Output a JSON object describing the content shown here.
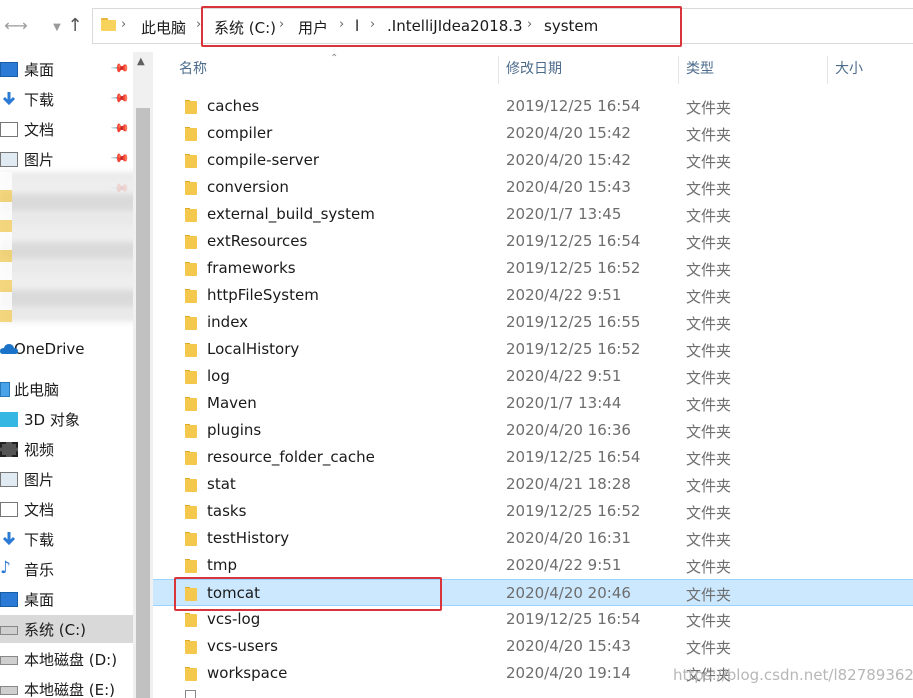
{
  "address_bar": {
    "breadcrumbs": [
      "此电脑",
      "系统 (C:)",
      "用户",
      "l",
      ".IntelliJIdea2018.3",
      "system"
    ],
    "highlight_color": "#d9343a"
  },
  "nav_pane": {
    "quick_access": [
      {
        "label": "桌面",
        "icon": "desktop-icon"
      },
      {
        "label": "下载",
        "icon": "download-icon"
      },
      {
        "label": "文档",
        "icon": "document-icon"
      },
      {
        "label": "图片",
        "icon": "picture-icon"
      }
    ],
    "onedrive": "OneDrive",
    "this_pc": {
      "label": "此电脑",
      "items": [
        {
          "label": "3D 对象",
          "icon": "3d-objects-icon"
        },
        {
          "label": "视频",
          "icon": "video-icon"
        },
        {
          "label": "图片",
          "icon": "picture-icon"
        },
        {
          "label": "文档",
          "icon": "document-icon"
        },
        {
          "label": "下载",
          "icon": "download-icon"
        },
        {
          "label": "音乐",
          "icon": "music-icon"
        },
        {
          "label": "桌面",
          "icon": "desktop-icon"
        },
        {
          "label": "系统 (C:)",
          "icon": "drive-icon",
          "selected": true
        },
        {
          "label": "本地磁盘 (D:)",
          "icon": "drive-icon"
        },
        {
          "label": "本地磁盘 (E:)",
          "icon": "drive-icon"
        }
      ]
    }
  },
  "columns": {
    "name": "名称",
    "modified": "修改日期",
    "type": "类型",
    "size": "大小"
  },
  "files": [
    {
      "name": "caches",
      "modified": "2019/12/25 16:54",
      "type": "文件夹"
    },
    {
      "name": "compiler",
      "modified": "2020/4/20 15:42",
      "type": "文件夹"
    },
    {
      "name": "compile-server",
      "modified": "2020/4/20 15:42",
      "type": "文件夹"
    },
    {
      "name": "conversion",
      "modified": "2020/4/20 15:43",
      "type": "文件夹"
    },
    {
      "name": "external_build_system",
      "modified": "2020/1/7 13:45",
      "type": "文件夹"
    },
    {
      "name": "extResources",
      "modified": "2019/12/25 16:54",
      "type": "文件夹"
    },
    {
      "name": "frameworks",
      "modified": "2019/12/25 16:52",
      "type": "文件夹"
    },
    {
      "name": "httpFileSystem",
      "modified": "2020/4/22 9:51",
      "type": "文件夹"
    },
    {
      "name": "index",
      "modified": "2019/12/25 16:55",
      "type": "文件夹"
    },
    {
      "name": "LocalHistory",
      "modified": "2019/12/25 16:52",
      "type": "文件夹"
    },
    {
      "name": "log",
      "modified": "2020/4/22 9:51",
      "type": "文件夹"
    },
    {
      "name": "Maven",
      "modified": "2020/1/7 13:44",
      "type": "文件夹"
    },
    {
      "name": "plugins",
      "modified": "2020/4/20 16:36",
      "type": "文件夹"
    },
    {
      "name": "resource_folder_cache",
      "modified": "2019/12/25 16:54",
      "type": "文件夹"
    },
    {
      "name": "stat",
      "modified": "2020/4/21 18:28",
      "type": "文件夹"
    },
    {
      "name": "tasks",
      "modified": "2019/12/25 16:52",
      "type": "文件夹"
    },
    {
      "name": "testHistory",
      "modified": "2020/4/20 16:31",
      "type": "文件夹"
    },
    {
      "name": "tmp",
      "modified": "2020/4/22 9:51",
      "type": "文件夹"
    },
    {
      "name": "tomcat",
      "modified": "2020/4/20 20:46",
      "type": "文件夹",
      "selected": true
    },
    {
      "name": "vcs-log",
      "modified": "2019/12/25 16:54",
      "type": "文件夹"
    },
    {
      "name": "vcs-users",
      "modified": "2020/4/20 15:43",
      "type": "文件夹"
    },
    {
      "name": "workspace",
      "modified": "2020/4/20 19:14",
      "type": "文件夹"
    }
  ],
  "watermark": "https://blog.csdn.net/l827893628"
}
